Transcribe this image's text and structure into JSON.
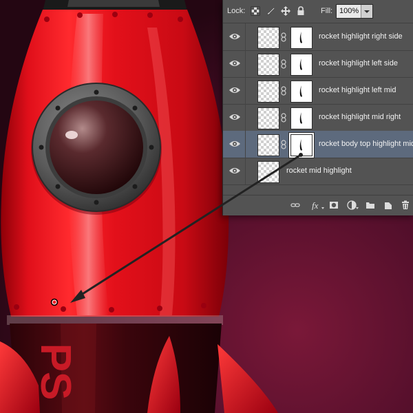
{
  "panel": {
    "lock_label": "Lock:",
    "fill_label": "Fill:",
    "fill_value": "100%",
    "layers": [
      {
        "name": "rocket highlight right side",
        "selected": false,
        "has_mask": true
      },
      {
        "name": "rocket highlight left side",
        "selected": false,
        "has_mask": true
      },
      {
        "name": "rocket highlight left mid",
        "selected": false,
        "has_mask": true
      },
      {
        "name": "rocket highlight mid right",
        "selected": false,
        "has_mask": true
      },
      {
        "name": "rocket body top highlight mid",
        "selected": true,
        "has_mask": true
      },
      {
        "name": "rocket mid highlight",
        "selected": false,
        "has_mask": false
      }
    ],
    "bottom_icons": [
      "link-icon",
      "fx-icon",
      "mask-icon",
      "adjustment-icon",
      "folder-icon",
      "new-layer-icon",
      "trash-icon"
    ]
  },
  "canvas": {
    "badge_text": "PS",
    "colors": {
      "rocket_red": "#e8111c",
      "background": "#3a0a1f",
      "panel_bg": "#535353",
      "selected_row": "#5d6a7d"
    }
  }
}
